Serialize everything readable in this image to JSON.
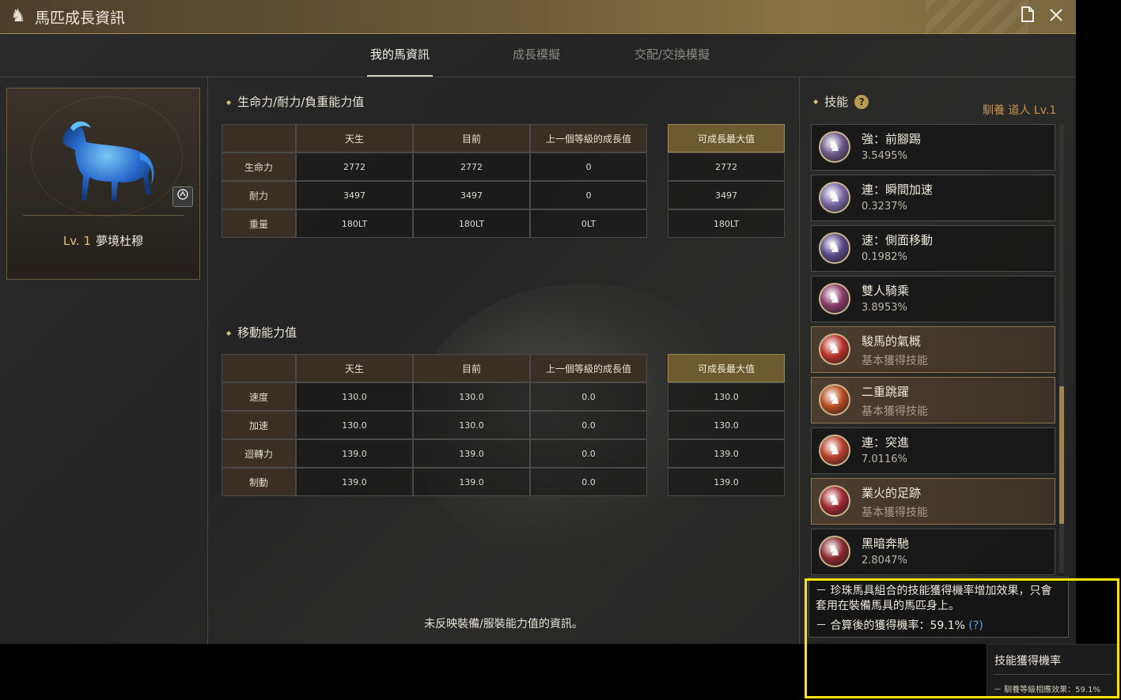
{
  "window": {
    "title": "馬匹成長資訊",
    "icons": {
      "logo": "horse-head-icon",
      "document": "document-icon",
      "close": "close-icon"
    }
  },
  "tabs": [
    {
      "label": "我的馬資訊",
      "active": true
    },
    {
      "label": "成長模擬",
      "active": false
    },
    {
      "label": "交配/交換模擬",
      "active": false
    }
  ],
  "horse": {
    "level": "Lv. 1",
    "name": "夢境杜穆"
  },
  "vitality_table": {
    "title": "生命力/耐力/負重能力值",
    "headers": [
      "天生",
      "目前",
      "上一個等級的成長值",
      "可成長最大值"
    ],
    "rows": [
      {
        "label": "生命力",
        "values": [
          "2772",
          "2772",
          "0",
          "2772"
        ]
      },
      {
        "label": "耐力",
        "values": [
          "3497",
          "3497",
          "0",
          "3497"
        ]
      },
      {
        "label": "重量",
        "values": [
          "180LT",
          "180LT",
          "0LT",
          "180LT"
        ]
      }
    ]
  },
  "movement_table": {
    "title": "移動能力值",
    "headers": [
      "天生",
      "目前",
      "上一個等級的成長值",
      "可成長最大值"
    ],
    "rows": [
      {
        "label": "速度",
        "values": [
          "130.0",
          "130.0",
          "0.0",
          "130.0"
        ]
      },
      {
        "label": "加速",
        "values": [
          "130.0",
          "130.0",
          "0.0",
          "130.0"
        ]
      },
      {
        "label": "迴轉力",
        "values": [
          "139.0",
          "139.0",
          "0.0",
          "139.0"
        ]
      },
      {
        "label": "制動",
        "values": [
          "139.0",
          "139.0",
          "0.0",
          "139.0"
        ]
      }
    ]
  },
  "footnote": "未反映裝備/服裝能力值的資訊。",
  "skills": {
    "title": "技能",
    "trainer": "馴養 道人 Lv.1",
    "items": [
      {
        "name": "強：前腳踢",
        "sub": "3.5495%",
        "basic": false,
        "icon": "front-kick-icon",
        "color": "#6a5a8a"
      },
      {
        "name": "連：瞬間加速",
        "sub": "0.3237%",
        "basic": false,
        "icon": "instant-accel-icon",
        "color": "#7a6aa8"
      },
      {
        "name": "速：側面移動",
        "sub": "0.1982%",
        "basic": false,
        "icon": "side-step-icon",
        "color": "#5a4a8a"
      },
      {
        "name": "雙人騎乘",
        "sub": "3.8953%",
        "basic": false,
        "icon": "double-ride-icon",
        "color": "#8a3a6a"
      },
      {
        "name": "駿馬的氣概",
        "sub": "基本獲得技能",
        "basic": true,
        "icon": "heart-icon",
        "color": "#b8322a"
      },
      {
        "name": "二重跳躍",
        "sub": "基本獲得技能",
        "basic": true,
        "icon": "double-jump-icon",
        "color": "#b84a20"
      },
      {
        "name": "連：突進",
        "sub": "7.0116%",
        "basic": false,
        "icon": "charge-icon",
        "color": "#b8402a"
      },
      {
        "name": "業火的足跡",
        "sub": "基本獲得技能",
        "basic": true,
        "icon": "fire-footprint-icon",
        "color": "#a02830"
      },
      {
        "name": "黑暗奔馳",
        "sub": "2.8047%",
        "basic": false,
        "icon": "dark-gallop-icon",
        "color": "#8a2a30"
      }
    ]
  },
  "info": {
    "line1": "－ 珍珠馬具組合的技能獲得機率增加效果，只會套用在裝備馬具的馬匹身上。",
    "line2": "－ 合算後的獲得機率：59.1%",
    "q": "(?)"
  },
  "tooltip": {
    "title": "技能獲得機率",
    "line": "－ 馴養等級相應效果：59.1%"
  }
}
